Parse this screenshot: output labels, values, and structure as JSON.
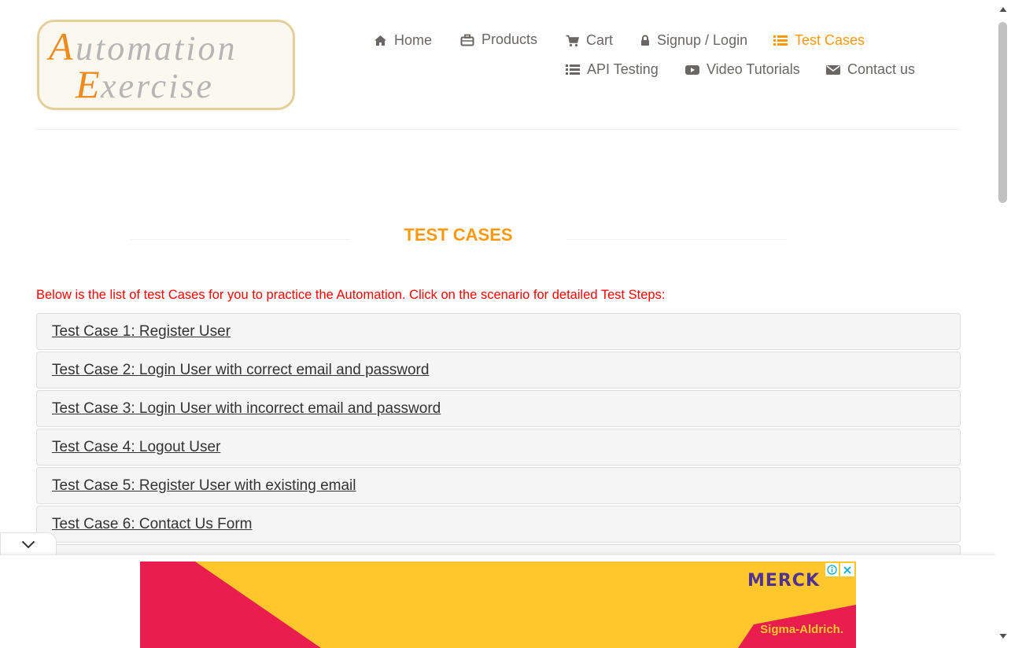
{
  "logo": {
    "line1": "Automation",
    "line2": "Exercise"
  },
  "nav": {
    "items": [
      {
        "label": "Home",
        "icon": "home-icon"
      },
      {
        "label": "Products",
        "icon": "briefcase-icon"
      },
      {
        "label": "Cart",
        "icon": "cart-icon"
      },
      {
        "label": "Signup / Login",
        "icon": "lock-icon"
      },
      {
        "label": "Test Cases",
        "icon": "list-icon",
        "active": true
      },
      {
        "label": "API Testing",
        "icon": "list-icon"
      },
      {
        "label": "Video Tutorials",
        "icon": "youtube-play-icon"
      },
      {
        "label": "Contact us",
        "icon": "envelope-icon"
      }
    ]
  },
  "page": {
    "title": "TEST CASES",
    "intro": "Below is the list of test Cases for you to practice the Automation. Click on the scenario for detailed Test Steps:"
  },
  "test_cases": [
    "Test Case 1: Register User",
    "Test Case 2: Login User with correct email and password",
    "Test Case 3: Login User with incorrect email and password",
    "Test Case 4: Logout User",
    "Test Case 5: Register User with existing email",
    "Test Case 6: Contact Us Form",
    ""
  ],
  "ad": {
    "brand": "MERCK",
    "sub_brand": "Sigma-Aldrich."
  },
  "colors": {
    "accent": "#fe980f",
    "intro_text": "#ff0000",
    "nav_text": "#696763",
    "ad_yellow": "#ffc72c",
    "ad_red": "#e91e4f"
  }
}
